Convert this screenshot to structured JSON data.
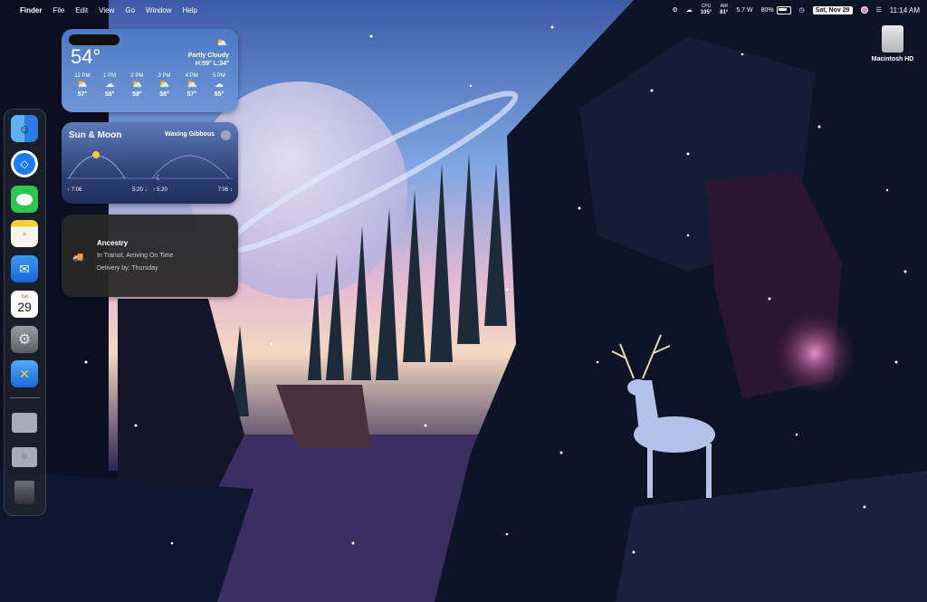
{
  "menubar": {
    "apple_icon": "apple-icon",
    "app_name": "Finder",
    "menus": [
      "File",
      "Edit",
      "View",
      "Go",
      "Window",
      "Help"
    ],
    "cpu_label": "CPU",
    "cpu_value": "105°",
    "air_label": "AIR",
    "air_value": "81°",
    "power": "5.7 W",
    "battery": "80%",
    "date": "Sat, Nov 29",
    "time": "11:14 AM"
  },
  "weather": {
    "temperature": "54°",
    "condition": "Partly Cloudy",
    "high_low": "H:59° L:34°",
    "hours": [
      {
        "time": "12 PM",
        "icon": "partly-cloudy",
        "temp": "57°"
      },
      {
        "time": "1 PM",
        "icon": "cloudy",
        "temp": "58°"
      },
      {
        "time": "2 PM",
        "icon": "partly-cloudy",
        "temp": "59°"
      },
      {
        "time": "3 PM",
        "icon": "partly-cloudy",
        "temp": "58°"
      },
      {
        "time": "4 PM",
        "icon": "partly-cloudy",
        "temp": "57°"
      },
      {
        "time": "5 PM",
        "icon": "cloudy",
        "temp": "55°"
      }
    ]
  },
  "sun_moon": {
    "title": "Sun & Moon",
    "phase": "Waxing Gibbous",
    "sunrise": "7:06",
    "sunset": "5:20",
    "moonrise": "5:20",
    "moonset": "7:06"
  },
  "ancestry": {
    "name": "Ancestry",
    "status": "In Transit, Arriving On Time",
    "delivery": "Delivery by: Thursday"
  },
  "dock": {
    "calendar_month": "Sat",
    "calendar_day": "29",
    "apps": [
      "finder",
      "safari",
      "messages",
      "notes",
      "mail",
      "calendar",
      "system-settings",
      "xcode-tools",
      "documents",
      "downloads",
      "trash"
    ]
  },
  "desktop": {
    "drive_label": "Macintosh HD"
  },
  "colors": {
    "weather_bg": "#5a86cf",
    "ancestry_truck": "#e58a45"
  }
}
